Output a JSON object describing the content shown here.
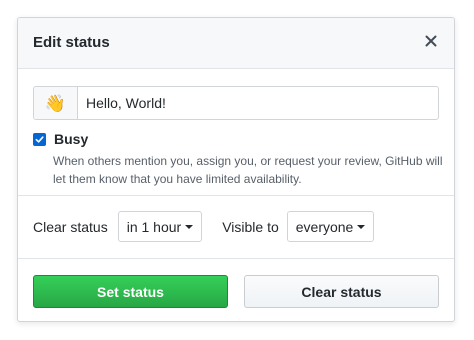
{
  "dialog": {
    "title": "Edit status",
    "close_icon": "close-icon"
  },
  "status": {
    "emoji": "👋",
    "text": "Hello, World!"
  },
  "busy": {
    "checked": true,
    "label": "Busy",
    "description": "When others mention you, assign you, or request your review, GitHub will let them know that you have limited availability."
  },
  "options": {
    "clear_label": "Clear status",
    "clear_value": "in 1 hour",
    "visible_label": "Visible to",
    "visible_value": "everyone"
  },
  "actions": {
    "set_label": "Set status",
    "clear_label": "Clear status"
  },
  "colors": {
    "primary": "#28a745",
    "checkbox": "#0366d6",
    "header_bg": "#f6f8fa"
  }
}
